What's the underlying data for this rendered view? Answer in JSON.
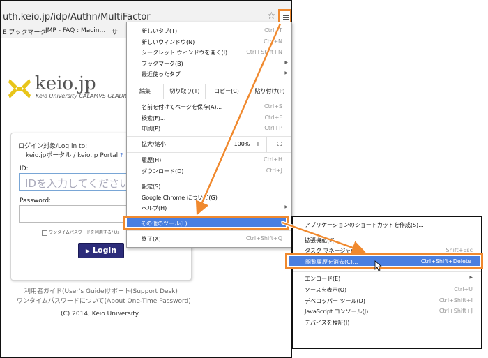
{
  "browser": {
    "url": "uth.keio.jp/idp/Authn/MultiFactor",
    "bookmarks": [
      "E ブックマーク",
      "JMP - FAQ : Macin…",
      "サ"
    ]
  },
  "page": {
    "logo_text": "keio.jp",
    "logo_sub": "Keio University CALAMVS GLADIO",
    "login_target": "ログイン対象/Log in to:",
    "login_portal": "keio.jpポータル / keio.jp Portal",
    "help_mark": "?",
    "id_label": "ID:",
    "id_placeholder": "IDを入力してください",
    "password_label": "Password:",
    "otp_checkbox": "ワンタイムパスワードを利用する/ Us",
    "login_button": "Login",
    "links": [
      "利用者ガイド(User's Guide)",
      "サポート(Support Desk)",
      "ワンタイムパスワードについて(About One-Time Password)"
    ],
    "copyright": "(C) 2014, Keio University."
  },
  "menu": {
    "items_top": [
      {
        "label": "新しいタブ(T)",
        "shortcut": "Ctrl+T"
      },
      {
        "label": "新しいウィンドウ(N)",
        "shortcut": "Ctrl+N"
      },
      {
        "label": "シークレット ウィンドウを開く(I)",
        "shortcut": "Ctrl+Shift+N"
      },
      {
        "label": "ブックマーク(B)",
        "shortcut": ""
      },
      {
        "label": "最近使ったタブ",
        "shortcut": ""
      }
    ],
    "edit": {
      "label": "編集",
      "cut": "切り取り(T)",
      "copy": "コピー(C)",
      "paste": "貼り付け(P)"
    },
    "items_file": [
      {
        "label": "名前を付けてページを保存(A)...",
        "shortcut": "Ctrl+S"
      },
      {
        "label": "検索(F)...",
        "shortcut": "Ctrl+F"
      },
      {
        "label": "印刷(P)...",
        "shortcut": "Ctrl+P"
      }
    ],
    "zoom": {
      "label": "拡大/縮小",
      "minus": "−",
      "value": "100%",
      "plus": "+",
      "fullscreen": "⛶"
    },
    "items_history": [
      {
        "label": "履歴(H)",
        "shortcut": "Ctrl+H"
      },
      {
        "label": "ダウンロード(D)",
        "shortcut": "Ctrl+J"
      }
    ],
    "items_settings": [
      {
        "label": "設定(S)",
        "shortcut": ""
      },
      {
        "label": "Google Chrome について(G)",
        "shortcut": ""
      },
      {
        "label": "ヘルプ(H)",
        "shortcut": ""
      }
    ],
    "more_tools": "その他のツール(L)",
    "exit": {
      "label": "終了(X)",
      "shortcut": "Ctrl+Shift+Q"
    }
  },
  "submenu": {
    "create_shortcut": "アプリケーションのショートカットを作成(S)...",
    "extensions": "拡張機能(E)",
    "task_manager": {
      "label": "タスク マネージャ(T)",
      "shortcut": "Shift+Esc"
    },
    "clear_data": {
      "label": "閲覧履歴を消去(C)...",
      "shortcut": "Ctrl+Shift+Delete"
    },
    "encoding": "エンコード(E)",
    "view_source": {
      "label": "ソースを表示(O)",
      "shortcut": "Ctrl+U"
    },
    "dev_tools": {
      "label": "デベロッパー ツール(D)",
      "shortcut": "Ctrl+Shift+I"
    },
    "js_console": {
      "label": "JavaScript コンソール(J)",
      "shortcut": "Ctrl+Shift+J"
    },
    "inspect_devices": "デバイスを検証(I)"
  },
  "colors": {
    "highlight_border": "#f0892e",
    "selection": "#4a7fe0",
    "login_button": "#2c2c7a"
  }
}
